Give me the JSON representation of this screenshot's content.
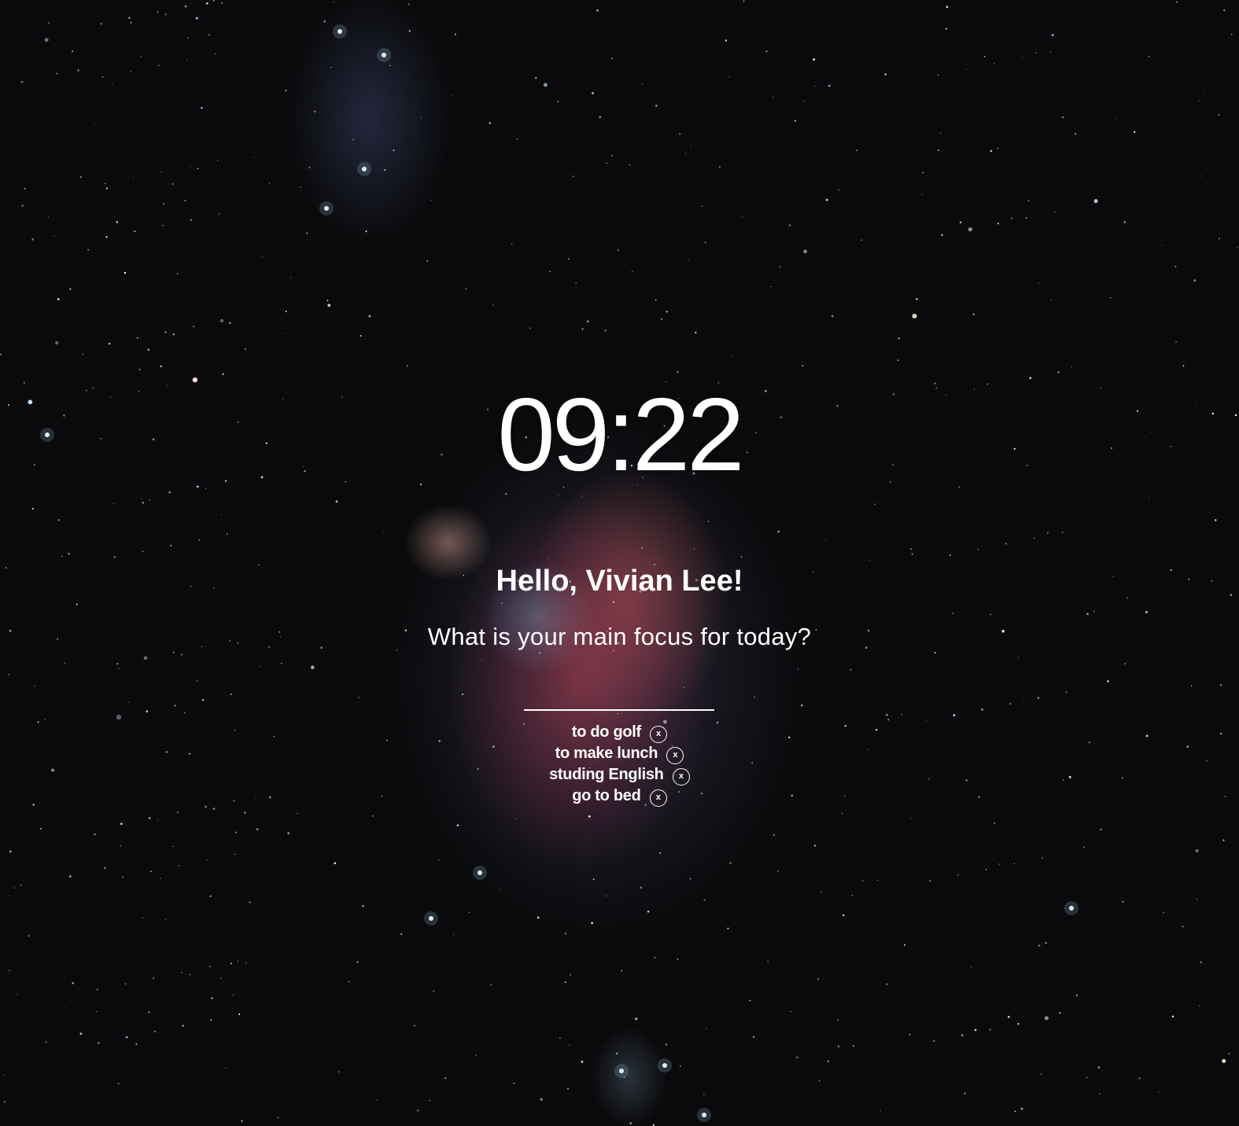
{
  "clock": {
    "time": "09:22"
  },
  "greeting": {
    "text": "Hello, Vivian Lee!"
  },
  "focus": {
    "question": "What is your main focus for today?",
    "input_value": ""
  },
  "todos": [
    {
      "text": "to do golf",
      "delete_label": "x"
    },
    {
      "text": "to make lunch",
      "delete_label": "x"
    },
    {
      "text": "studing English",
      "delete_label": "x"
    },
    {
      "text": "go to bed",
      "delete_label": "x"
    }
  ],
  "background": {
    "image": "orion-nebula-starfield"
  },
  "colors": {
    "text": "#ffffff",
    "background": "#0a0a0c"
  }
}
